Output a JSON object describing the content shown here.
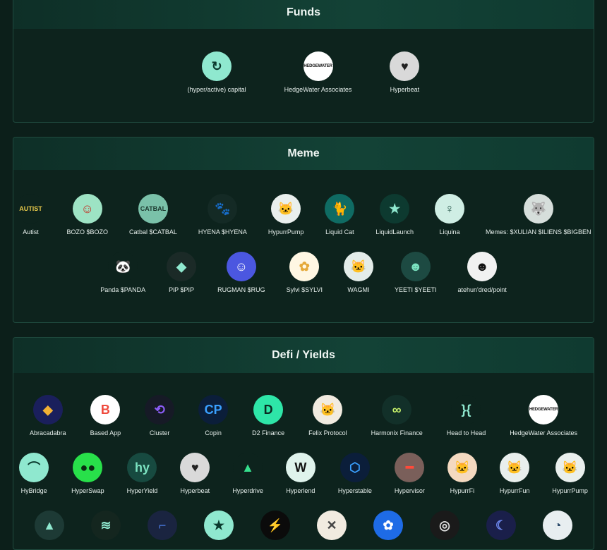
{
  "funds": {
    "title": "Funds",
    "items": [
      {
        "label": "(hyper/active) capital",
        "icon": "hyper-active-capital-icon",
        "bg": "#8fe8cf",
        "fg": "#0b3a2e",
        "glyph": "↻"
      },
      {
        "label": "HedgeWater Associates",
        "icon": "hedgewater-icon",
        "bg": "#ffffff",
        "fg": "#111111",
        "glyph": "HEDGEWATER"
      },
      {
        "label": "Hyperbeat",
        "icon": "hyperbeat-icon",
        "bg": "#d9d9d9",
        "fg": "#222222",
        "glyph": "♥"
      }
    ]
  },
  "meme": {
    "title": "Meme",
    "rows": [
      [
        {
          "label": "Autist",
          "icon": "autist-icon",
          "bg": "#0d231d",
          "fg": "#e6c84a",
          "glyph": "AUTIST"
        },
        {
          "label": "BOZO $BOZO",
          "icon": "bozo-icon",
          "bg": "#9de3c4",
          "fg": "#c0392b",
          "glyph": "☺"
        },
        {
          "label": "Catbal $CATBAL",
          "icon": "catbal-icon",
          "bg": "#7ac1a9",
          "fg": "#1d3a30",
          "glyph": "CATBAL"
        },
        {
          "label": "HYENA $HYENA",
          "icon": "hyena-icon",
          "bg": "#142a25",
          "fg": "#cfd8d5",
          "glyph": "🐾"
        },
        {
          "label": "HypurrPump",
          "icon": "hypurrpump-icon",
          "bg": "#e9efed",
          "fg": "#6b8a80",
          "glyph": "🐱"
        },
        {
          "label": "Liquid Cat",
          "icon": "liquid-cat-icon",
          "bg": "#0f6b63",
          "fg": "#bff1e3",
          "glyph": "🐈"
        },
        {
          "label": "LiquidLaunch",
          "icon": "liquidlaunch-icon",
          "bg": "#0d3a30",
          "fg": "#8fe8cf",
          "glyph": "★"
        },
        {
          "label": "Liquina",
          "icon": "liquina-icon",
          "bg": "#cfeee4",
          "fg": "#2f5e52",
          "glyph": "♀"
        },
        {
          "label": "Memes: $XULIAN $ILIENS $BIGBEN",
          "icon": "memes-icon",
          "bg": "#d6dedb",
          "fg": "#3b4a45",
          "glyph": "🐺"
        }
      ],
      [
        {
          "label": "Panda $PANDA",
          "icon": "panda-icon",
          "bg": "#0d231d",
          "fg": "#ffffff",
          "glyph": "🐼"
        },
        {
          "label": "PiP $PIP",
          "icon": "pip-icon",
          "bg": "#1b2a27",
          "fg": "#8fe8cf",
          "glyph": "◆"
        },
        {
          "label": "RUGMAN $RUG",
          "icon": "rugman-icon",
          "bg": "#4b57e0",
          "fg": "#ffffff",
          "glyph": "☺"
        },
        {
          "label": "Sylvi $SYLVI",
          "icon": "sylvi-icon",
          "bg": "#fff7e3",
          "fg": "#e5a93a",
          "glyph": "✿"
        },
        {
          "label": "WAGMI",
          "icon": "wagmi-icon",
          "bg": "#e3ece9",
          "fg": "#6a7f79",
          "glyph": "🐱"
        },
        {
          "label": "YEETI $YEETI",
          "icon": "yeeti-icon",
          "bg": "#1d4a42",
          "fg": "#7be3c1",
          "glyph": "☻"
        },
        {
          "label": "atehun'dred/point",
          "icon": "atehundred-icon",
          "bg": "#f1f1f1",
          "fg": "#111111",
          "glyph": "☻"
        }
      ]
    ]
  },
  "defi": {
    "title": "Defi / Yields",
    "rows": [
      [
        {
          "label": "Abracadabra",
          "icon": "abracadabra-icon",
          "bg": "#1a1f5c",
          "fg": "#f2b134",
          "glyph": "◆"
        },
        {
          "label": "Based App",
          "icon": "based-app-icon",
          "bg": "#ffffff",
          "fg": "#ef4a3c",
          "glyph": "B"
        },
        {
          "label": "Cluster",
          "icon": "cluster-icon",
          "bg": "#161a26",
          "fg": "#8b5cf6",
          "glyph": "⟲"
        },
        {
          "label": "Copin",
          "icon": "copin-icon",
          "bg": "#0b1e3a",
          "fg": "#3aa0ff",
          "glyph": "CP"
        },
        {
          "label": "D2 Finance",
          "icon": "d2-finance-icon",
          "bg": "#2ee6a8",
          "fg": "#0b2b22",
          "glyph": "D"
        },
        {
          "label": "Felix Protocol",
          "icon": "felix-protocol-icon",
          "bg": "#f1ebe0",
          "fg": "#222222",
          "glyph": "🐱"
        },
        {
          "label": "Harmonix Finance",
          "icon": "harmonix-finance-icon",
          "bg": "#123029",
          "fg": "#c6f06a",
          "glyph": "∞"
        },
        {
          "label": "Head to Head",
          "icon": "head-to-head-icon",
          "bg": "#0d231d",
          "fg": "#8fe8cf",
          "glyph": "}{"
        },
        {
          "label": "HedgeWater Associates",
          "icon": "hedgewater-icon",
          "bg": "#ffffff",
          "fg": "#111111",
          "glyph": "HEDGEWATER"
        }
      ],
      [
        {
          "label": "HyBridge",
          "icon": "hybridge-icon",
          "bg": "#8fe8cf",
          "fg": "#0b3a2e",
          "glyph": "⌒"
        },
        {
          "label": "HyperSwap",
          "icon": "hyperswap-icon",
          "bg": "#28e04a",
          "fg": "#0b2b12",
          "glyph": "●●"
        },
        {
          "label": "HyperYield",
          "icon": "hyperyield-icon",
          "bg": "#174a40",
          "fg": "#7be3c1",
          "glyph": "hy"
        },
        {
          "label": "Hyperbeat",
          "icon": "hyperbeat-icon",
          "bg": "#d9d9d9",
          "fg": "#222222",
          "glyph": "♥"
        },
        {
          "label": "Hyperdrive",
          "icon": "hyperdrive-icon",
          "bg": "#0d231d",
          "fg": "#36e08e",
          "glyph": "▲"
        },
        {
          "label": "Hyperlend",
          "icon": "hyperlend-icon",
          "bg": "#dff3ec",
          "fg": "#111111",
          "glyph": "W"
        },
        {
          "label": "Hyperstable",
          "icon": "hyperstable-icon",
          "bg": "#0b1e3a",
          "fg": "#3aa0ff",
          "glyph": "⬡"
        },
        {
          "label": "Hypervisor",
          "icon": "hypervisor-icon",
          "bg": "#7a5f5a",
          "fg": "#ff4a3a",
          "glyph": "━"
        },
        {
          "label": "HypurrFi",
          "icon": "hypurrfi-icon",
          "bg": "#f4d9c0",
          "fg": "#e0793a",
          "glyph": "🐱"
        },
        {
          "label": "HypurrFun",
          "icon": "hypurrfun-icon",
          "bg": "#e9efed",
          "fg": "#6b8a80",
          "glyph": "🐱"
        },
        {
          "label": "HypurrPump",
          "icon": "hypurrpump-icon",
          "bg": "#e9efed",
          "fg": "#6b8a80",
          "glyph": "🐱"
        }
      ],
      [
        {
          "label": "",
          "icon": "lion-icon",
          "bg": "#1d3a35",
          "fg": "#8fe8cf",
          "glyph": "▲"
        },
        {
          "label": "",
          "icon": "stripes-icon",
          "bg": "#14261f",
          "fg": "#8fe8cf",
          "glyph": "≋"
        },
        {
          "label": "",
          "icon": "square-logo-icon",
          "bg": "#1a2440",
          "fg": "#4a7ae0",
          "glyph": "⌐"
        },
        {
          "label": "",
          "icon": "star-logo-icon",
          "bg": "#8fe8cf",
          "fg": "#0b3a2e",
          "glyph": "★"
        },
        {
          "label": "",
          "icon": "lightning-icon",
          "bg": "#0b0b0b",
          "fg": "#f2c12e",
          "glyph": "⚡"
        },
        {
          "label": "",
          "icon": "x-logo-icon",
          "bg": "#f1ebe0",
          "fg": "#444444",
          "glyph": "✕"
        },
        {
          "label": "",
          "icon": "flower-logo-icon",
          "bg": "#1e6be6",
          "fg": "#ffffff",
          "glyph": "✿"
        },
        {
          "label": "",
          "icon": "ring-logo-icon",
          "bg": "#1a1a1a",
          "fg": "#dddddd",
          "glyph": "◎"
        },
        {
          "label": "",
          "icon": "swirl-logo-icon",
          "bg": "#1a1f4a",
          "fg": "#6f8af0",
          "glyph": "☾"
        },
        {
          "label": "",
          "icon": "pie-logo-icon",
          "bg": "#e8eef0",
          "fg": "#2b4a6a",
          "glyph": "◔"
        }
      ]
    ]
  }
}
